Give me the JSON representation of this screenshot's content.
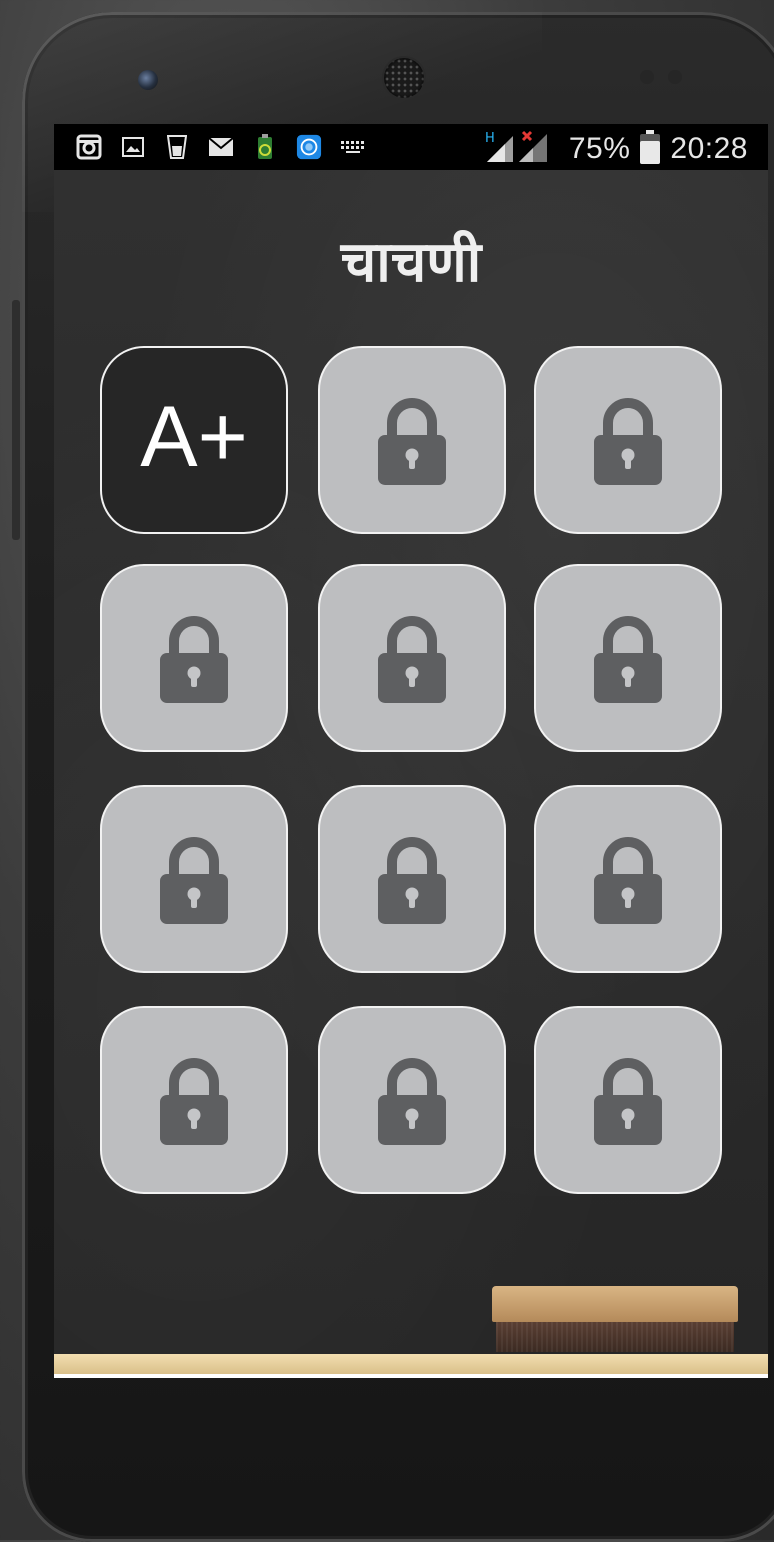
{
  "status_bar": {
    "notification_icons": [
      "instagram-icon",
      "image-icon",
      "cup-icon",
      "mail-icon",
      "battery-app-icon",
      "app-icon",
      "keyboard-icon"
    ],
    "network_indicator": "H",
    "battery_text": "75%",
    "battery_level_percent": 75,
    "time": "20:28"
  },
  "screen": {
    "title": "चाचणी",
    "levels": [
      {
        "label": "A+",
        "locked": false
      },
      {
        "label": "",
        "locked": true
      },
      {
        "label": "",
        "locked": true
      },
      {
        "label": "",
        "locked": true
      },
      {
        "label": "",
        "locked": true
      },
      {
        "label": "",
        "locked": true
      },
      {
        "label": "",
        "locked": true
      },
      {
        "label": "",
        "locked": true
      },
      {
        "label": "",
        "locked": true
      },
      {
        "label": "",
        "locked": true
      },
      {
        "label": "",
        "locked": true
      },
      {
        "label": "",
        "locked": true
      }
    ]
  },
  "colors": {
    "chalkboard": "#2b2b2b",
    "locked_tile": "#bdbec0",
    "lock_icon": "#5e5f61",
    "tile_border": "#f2f2f2",
    "title_text": "#efefef"
  }
}
